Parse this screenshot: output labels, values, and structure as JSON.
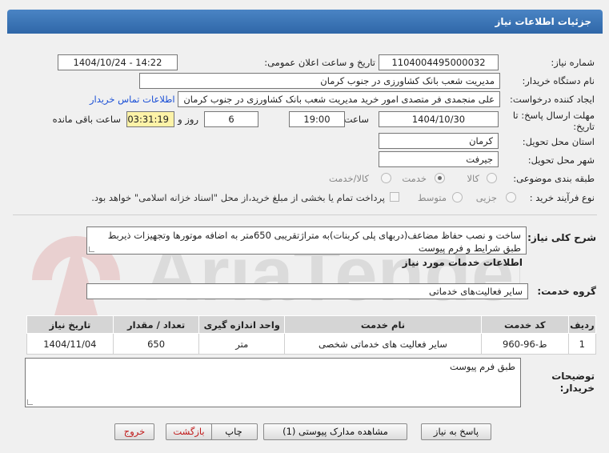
{
  "header": {
    "title": "جزئیات اطلاعات نیاز"
  },
  "fields": {
    "need_number_label": "شماره نیاز:",
    "need_number": "1104004495000032",
    "announce_label": "تاریخ و ساعت اعلان عمومی:",
    "announce_value": "1404/10/24 - 14:22",
    "buyer_org_label": "نام دستگاه خریدار:",
    "buyer_org": "مدیریت شعب بانک کشاورزی در جنوب کرمان",
    "creator_label": "ایجاد کننده درخواست:",
    "creator": "علی منجمدی فر  متصدی امور خرید  مدیریت شعب بانک کشاورزی در جنوب کرمان",
    "contact_link": "اطلاعات تماس خریدار",
    "deadline_label_1": "مهلت ارسال پاسخ: تا",
    "deadline_label_2": "تاریخ:",
    "deadline_date": "1404/10/30",
    "time_label": "ساعت",
    "deadline_time": "19:00",
    "days_value": "6",
    "days_label": "روز و",
    "remaining_time": "03:31:19",
    "remaining_label": "ساعت باقی مانده",
    "province_label": "استان محل تحویل:",
    "province": "کرمان",
    "city_label": "شهر محل تحویل:",
    "city": "جیرفت"
  },
  "category": {
    "label": "طبقه بندی موضوعی:",
    "options": [
      "کالا",
      "خدمت",
      "کالا/خدمت"
    ],
    "selected": "خدمت"
  },
  "purchase": {
    "label": "نوع فرآیند خرید :",
    "options": [
      "جزیی",
      "متوسط"
    ],
    "checkbox_text": "پرداخت تمام یا بخشی از مبلغ خرید،از محل \"اسناد خزانه اسلامی\" خواهد بود."
  },
  "summary": {
    "label": "شرح کلی نیاز:",
    "text": "ساخت و نصب حفاظ مضاعف(دربهای پلی کربنات)به متراژتقریبی 650متر به اضافه موتورها وتجهیزات ذیربط طبق شرایط و فرم پیوست"
  },
  "services": {
    "section_title": "اطلاعات خدمات مورد نیاز",
    "group_label": "گروه خدمت:",
    "group_value": "سایر فعالیت‌های خدماتی",
    "columns": [
      "ردیف",
      "کد خدمت",
      "نام خدمت",
      "واحد اندازه گیری",
      "تعداد / مقدار",
      "تاریخ نیاز"
    ],
    "rows": [
      {
        "row": "1",
        "code": "ط-96-960",
        "name": "سایر فعالیت های خدماتی شخصی",
        "unit": "متر",
        "qty": "650",
        "date": "1404/11/04"
      }
    ]
  },
  "buyer_notes": {
    "label_1": "توضیحات",
    "label_2": "خریدار:",
    "text": "طبق فرم پیوست"
  },
  "buttons": {
    "reply": "پاسخ به نیاز",
    "attachments": "مشاهده مدارک پیوستی (1)",
    "print": "چاپ",
    "back": "بازگشت",
    "exit": "خروج"
  },
  "watermark": {
    "text": "AriaTender.net"
  },
  "colors": {
    "header": "#3a74b8",
    "link": "#1a4fd6",
    "timer_bg": "#fdf3a8",
    "danger": "#c01818"
  }
}
